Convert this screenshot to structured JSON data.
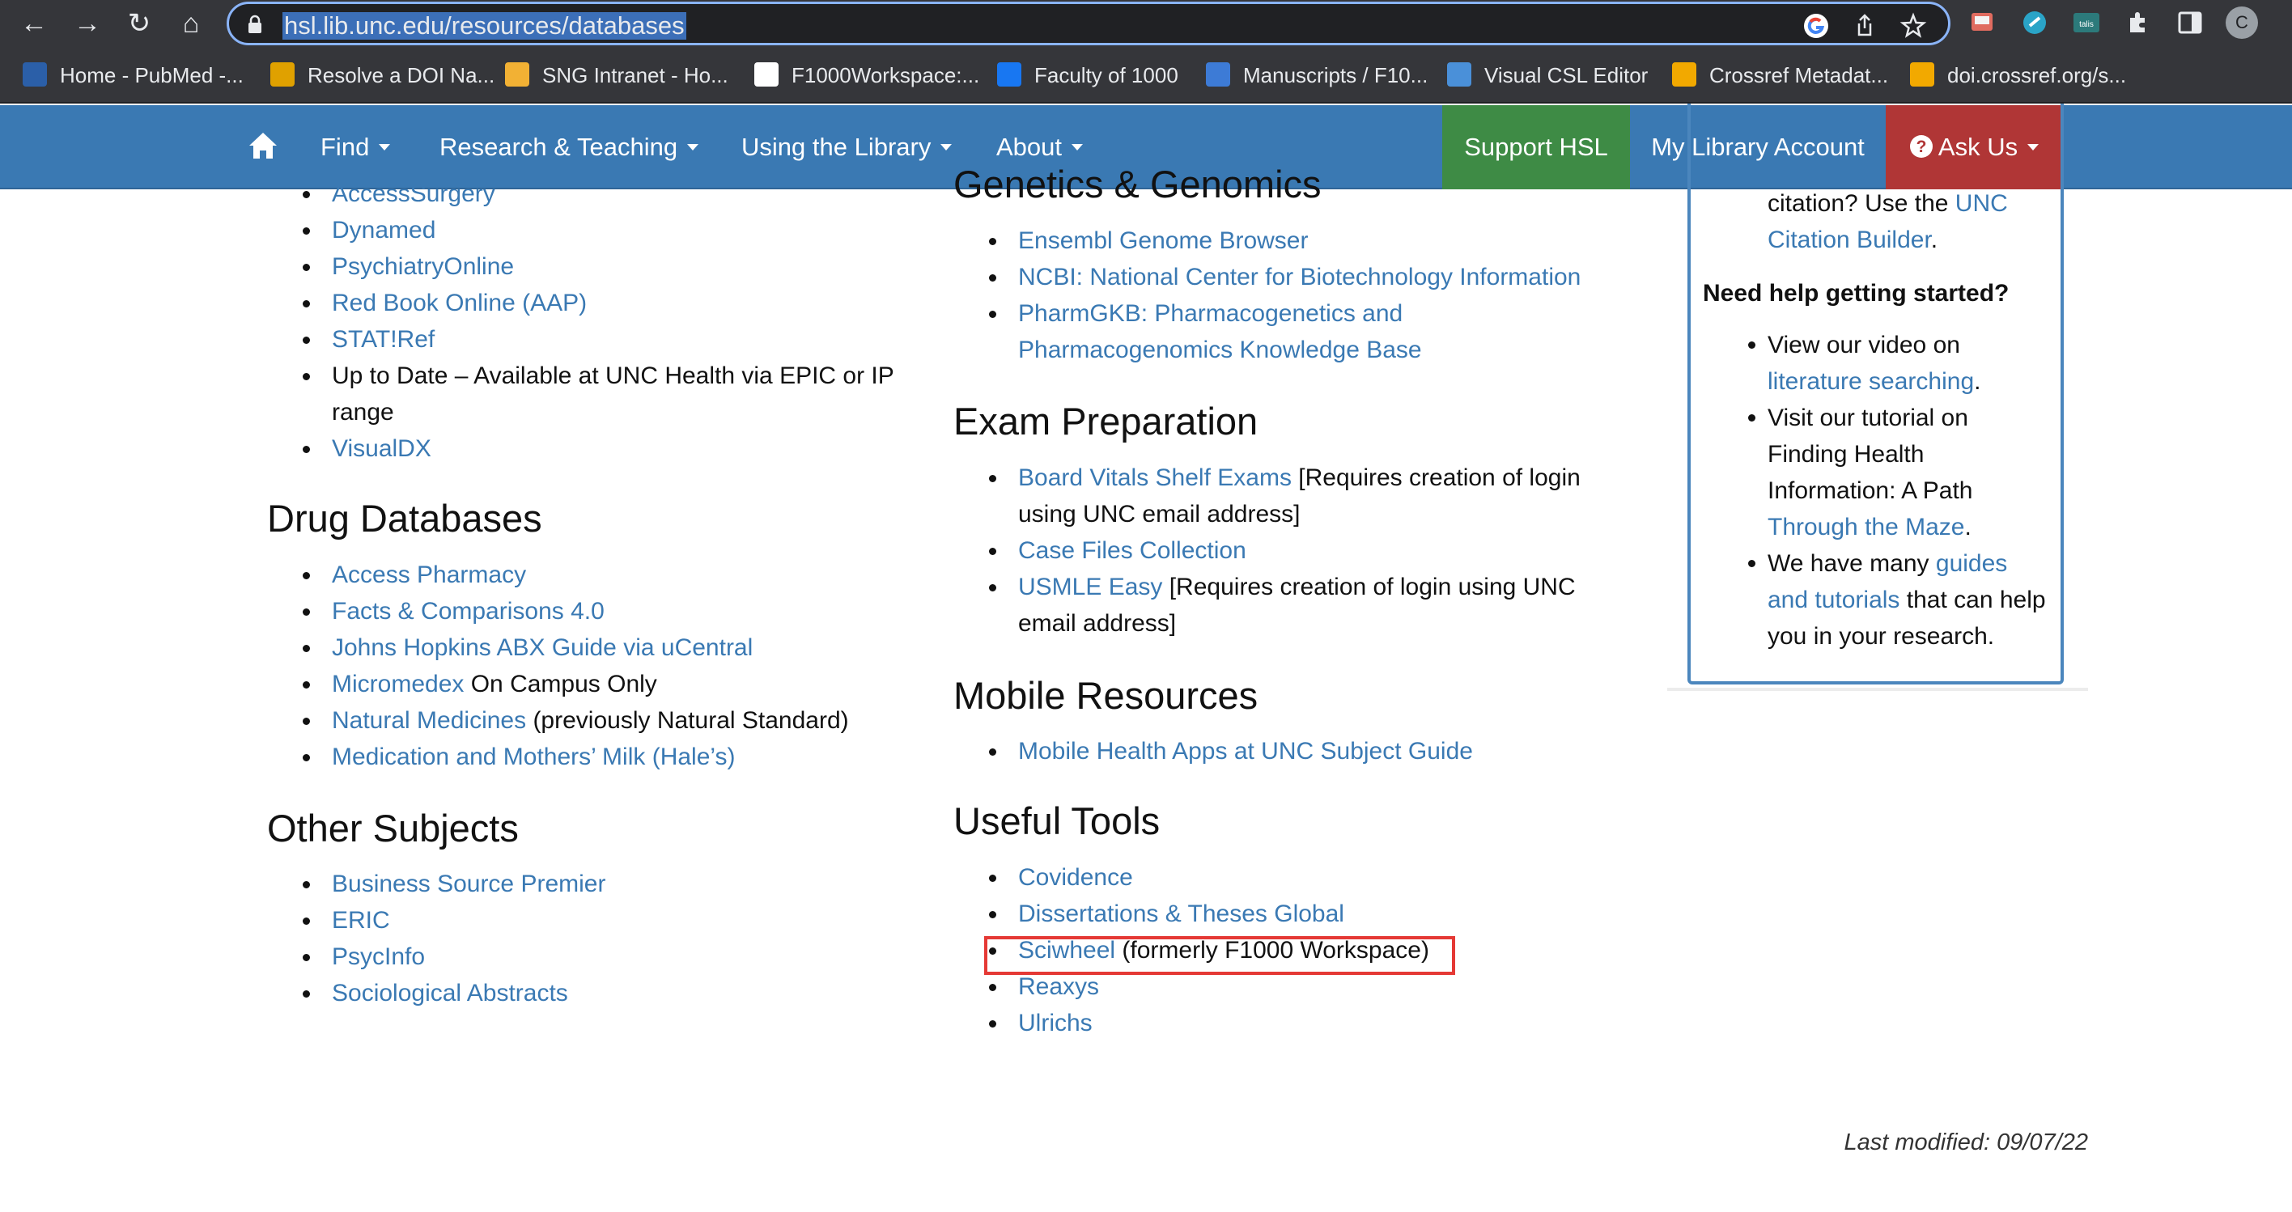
{
  "browser": {
    "url": "hsl.lib.unc.edu/resources/databases",
    "profile_initial": "C",
    "bookmarks": [
      {
        "label": "Home - PubMed -...",
        "color": "#2b5fa8"
      },
      {
        "label": "Resolve a DOI Na...",
        "color": "#e0a100"
      },
      {
        "label": "SNG Intranet - Ho...",
        "color": "#f2b134"
      },
      {
        "label": "F1000Workspace:...",
        "color": "#ffffff"
      },
      {
        "label": "Faculty of 1000",
        "color": "#1877f2"
      },
      {
        "label": "Manuscripts / F10...",
        "color": "#3d7bd6"
      },
      {
        "label": "Visual CSL Editor",
        "color": "#4a90d9"
      },
      {
        "label": "Crossref Metadat...",
        "color": "#f2a900"
      },
      {
        "label": "doi.crossref.org/s...",
        "color": "#f2a900"
      }
    ]
  },
  "site_nav": {
    "items": [
      "Find",
      "Research & Teaching",
      "Using the Library",
      "About"
    ],
    "support": "Support HSL",
    "account": "My Library Account",
    "ask": "Ask Us"
  },
  "left_column": {
    "top_list": [
      {
        "link": "AccessSurgery",
        "rest": ""
      },
      {
        "link": "Dynamed",
        "rest": ""
      },
      {
        "link": "PsychiatryOnline",
        "rest": ""
      },
      {
        "link": "Red Book Online (AAP)",
        "rest": ""
      },
      {
        "link": "STAT!Ref",
        "rest": ""
      },
      {
        "link": "",
        "rest": "Up to Date – Available at UNC Health via EPIC or IP"
      },
      {
        "link": "",
        "rest": "range"
      },
      {
        "link": "VisualDX",
        "rest": ""
      }
    ],
    "drug_heading": "Drug Databases",
    "drug_list": [
      {
        "link": "Access Pharmacy",
        "rest": ""
      },
      {
        "link": "Facts & Comparisons 4.0",
        "rest": ""
      },
      {
        "link": "Johns Hopkins ABX Guide via uCentral",
        "rest": ""
      },
      {
        "link": "Micromedex",
        "rest": " On Campus Only"
      },
      {
        "link": "Natural Medicines",
        "rest": " (previously Natural Standard)"
      },
      {
        "link": "Medication and Mothers’ Milk (Hale’s)",
        "rest": ""
      }
    ],
    "other_heading": "Other Subjects",
    "other_list": [
      {
        "link": "Business Source Premier",
        "rest": ""
      },
      {
        "link": "ERIC",
        "rest": ""
      },
      {
        "link": "PsycInfo",
        "rest": ""
      },
      {
        "link": "Sociological Abstracts",
        "rest": ""
      }
    ]
  },
  "middle_column": {
    "genetics_heading": "Genetics & Genomics",
    "genetics_list": [
      {
        "link": "Ensembl Genome Browser",
        "rest": ""
      },
      {
        "link": "NCBI: National Center for Biotechnology Information",
        "rest": ""
      },
      {
        "link": "PharmGKB: Pharmacogenetics and",
        "rest": ""
      },
      {
        "link": "Pharmacogenomics Knowledge Base",
        "rest": ""
      }
    ],
    "exam_heading": "Exam Preparation",
    "exam_list": [
      {
        "link": "Board Vitals Shelf Exams",
        "rest": " [Requires creation of login"
      },
      {
        "link": "",
        "rest": "using UNC email address]"
      },
      {
        "link": "Case Files Collection",
        "rest": ""
      },
      {
        "link": "USMLE Easy",
        "rest": " [Requires creation of login using UNC"
      },
      {
        "link": "",
        "rest": "email address]"
      }
    ],
    "mobile_heading": "Mobile Resources",
    "mobile_list": [
      {
        "link": "Mobile Health Apps at UNC Subject Guide",
        "rest": ""
      }
    ],
    "tools_heading": "Useful Tools",
    "tools_list": [
      {
        "link": "Covidence",
        "rest": ""
      },
      {
        "link": "Dissertations & Theses Global",
        "rest": ""
      },
      {
        "link": "Sciwheel",
        "rest": " (formerly F1000 Workspace)"
      },
      {
        "link": "Reaxys",
        "rest": ""
      },
      {
        "link": "Ulrichs",
        "rest": ""
      }
    ]
  },
  "sidebar": {
    "citation_prefix": "citation? Use the ",
    "citation_link_1": "UNC",
    "citation_link_2": "Citation Builder",
    "citation_suffix": ".",
    "help_heading": "Need help getting started?",
    "b1_text": "View our video on",
    "b1_link": "literature searching",
    "b1_suffix": ".",
    "b2_text": "Visit our tutorial on",
    "b2_link_1": "Finding Health",
    "b2_link_2": "Information: A Path",
    "b2_link_3": "Through the Maze",
    "b2_suffix": ".",
    "b3_text": "We have many ",
    "b3_link_1": "guides",
    "b3_link_2": "and tutorials",
    "b3_text_2": " that can help",
    "b3_text_3": "you in your research."
  },
  "footer": {
    "last_modified": "Last modified: 09/07/22"
  },
  "colors": {
    "nav_blue": "#3a79b3",
    "support_green": "#3e8b45",
    "ask_red": "#b03636",
    "link_blue": "#3a79b3",
    "highlight_red": "#e53935"
  }
}
